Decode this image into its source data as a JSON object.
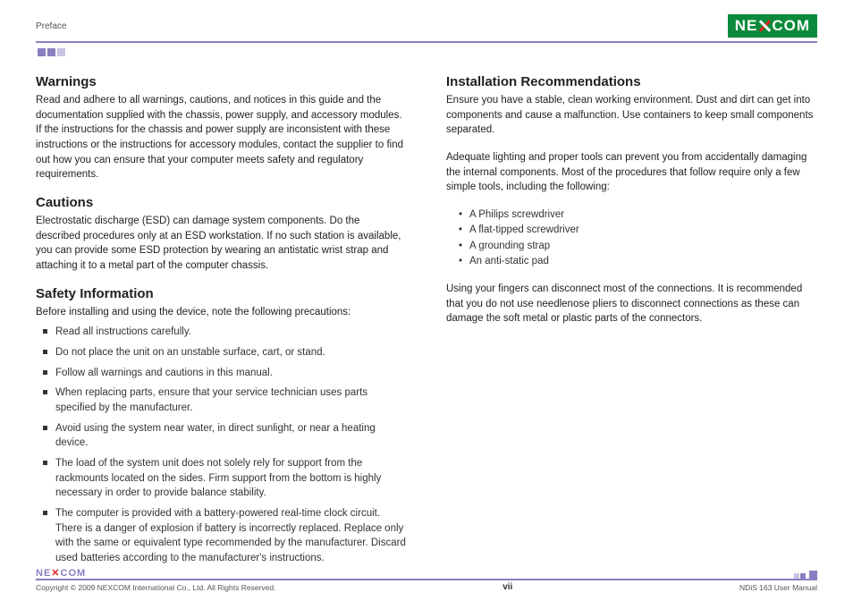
{
  "header": {
    "section": "Preface",
    "logo_text_left": "NE",
    "logo_text_right": "COM"
  },
  "left": {
    "warnings": {
      "title": "Warnings",
      "body": "Read and adhere to all warnings, cautions, and notices in this guide and the documentation supplied with the chassis, power supply, and accessory modules. If the instructions for the chassis and power supply are inconsistent  with these instructions or the instructions for accessory modules, contact the supplier to find out how you can ensure that your computer meets safety and regulatory requirements."
    },
    "cautions": {
      "title": "Cautions",
      "body": "Electrostatic discharge (ESD) can damage system components. Do the described procedures only at an ESD workstation. If no such station is available, you can provide some ESD protection by wearing an antistatic wrist strap and attaching it to a metal part of the computer chassis."
    },
    "safety": {
      "title": "Safety Information",
      "intro": "Before installing and using the device, note the following precautions:",
      "items": [
        "Read all instructions carefully.",
        "Do not place the unit on an unstable surface, cart, or stand.",
        "Follow all warnings and cautions in this manual.",
        "When replacing parts, ensure that your service technician uses parts specified by the manufacturer.",
        "Avoid using the system near water, in direct sunlight, or near a heating device.",
        "The load of the system unit does not solely rely for support from the rackmounts located on the sides. Firm support from the bottom is highly necessary in order to provide balance stability.",
        "The computer is provided with a battery-powered real-time clock circuit. There is a danger of explosion if battery is incorrectly replaced. Replace only with the same or equivalent type recommended by the manufacturer. Discard used batteries according to the manufacturer's instructions."
      ]
    }
  },
  "right": {
    "install": {
      "title": "Installation Recommendations",
      "p1": "Ensure you have a stable, clean working environment. Dust and dirt can get into components and cause a malfunction. Use containers to keep small components separated.",
      "p2": "Adequate lighting and proper tools can prevent you from accidentally damaging the internal components. Most of the procedures that follow require only a few simple tools, including the following:",
      "tools": [
        "A Philips screwdriver",
        "A flat-tipped screwdriver",
        "A grounding strap",
        "An anti-static pad"
      ],
      "p3": "Using your fingers can disconnect most of the connections. It is recommended that you do not use needlenose pliers to disconnect connections as these can damage the soft metal or plastic parts of the connectors."
    }
  },
  "footer": {
    "logo": "NE COM",
    "copyright": "Copyright © 2009 NEXCOM International Co., Ltd. All Rights Reserved.",
    "page": "vii",
    "doc": "NDiS 163 User Manual"
  }
}
